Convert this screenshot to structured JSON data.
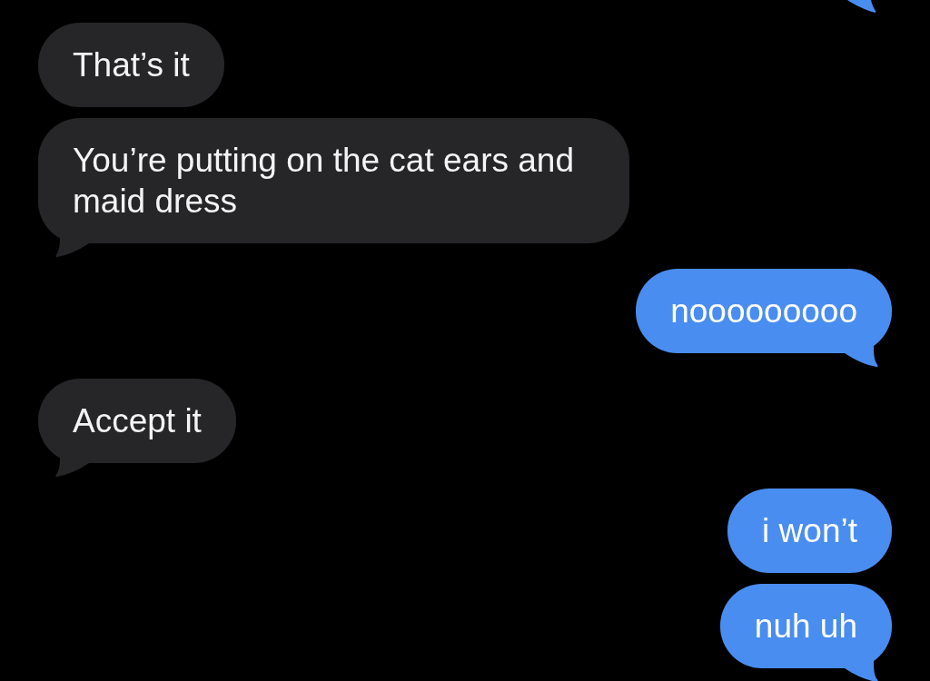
{
  "messages": [
    {
      "kind": "incoming",
      "text": "That’s it",
      "tail": false
    },
    {
      "kind": "incoming",
      "text": "You’re putting on the cat ears and maid dress",
      "tail": true
    },
    {
      "kind": "outgoing",
      "text": "nooooooooo",
      "tail": true
    },
    {
      "kind": "incoming",
      "text": "Accept it",
      "tail": true
    },
    {
      "kind": "outgoing",
      "text": "i won’t",
      "tail": false
    },
    {
      "kind": "outgoing",
      "text": "nuh uh",
      "tail": true
    }
  ]
}
